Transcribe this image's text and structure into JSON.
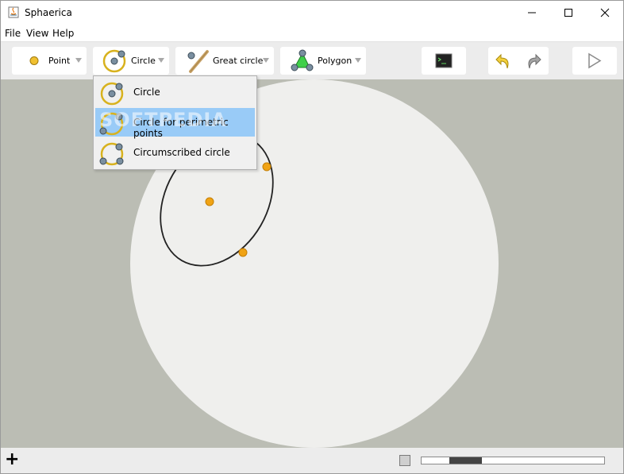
{
  "window": {
    "title": "Sphaerica"
  },
  "menu": {
    "items": [
      "File",
      "View",
      "Help"
    ]
  },
  "toolbar": {
    "point_label": "Point",
    "circle_label": "Circle",
    "great_circle_label": "Great circle",
    "polygon_label": "Polygon"
  },
  "dropdown": {
    "items": [
      "Circle",
      "Circle for perimetric points",
      "Circumscribed circle"
    ],
    "selected_index": 1
  },
  "watermark": "SOFTPEDIA",
  "statusbar": {
    "add_label": "+",
    "zoom_slider_value": 0.2
  },
  "colors": {
    "point": "#f0a315",
    "canvas": "#bbbdb4",
    "sphere": "#efefed",
    "selection": "#99cbf7"
  }
}
